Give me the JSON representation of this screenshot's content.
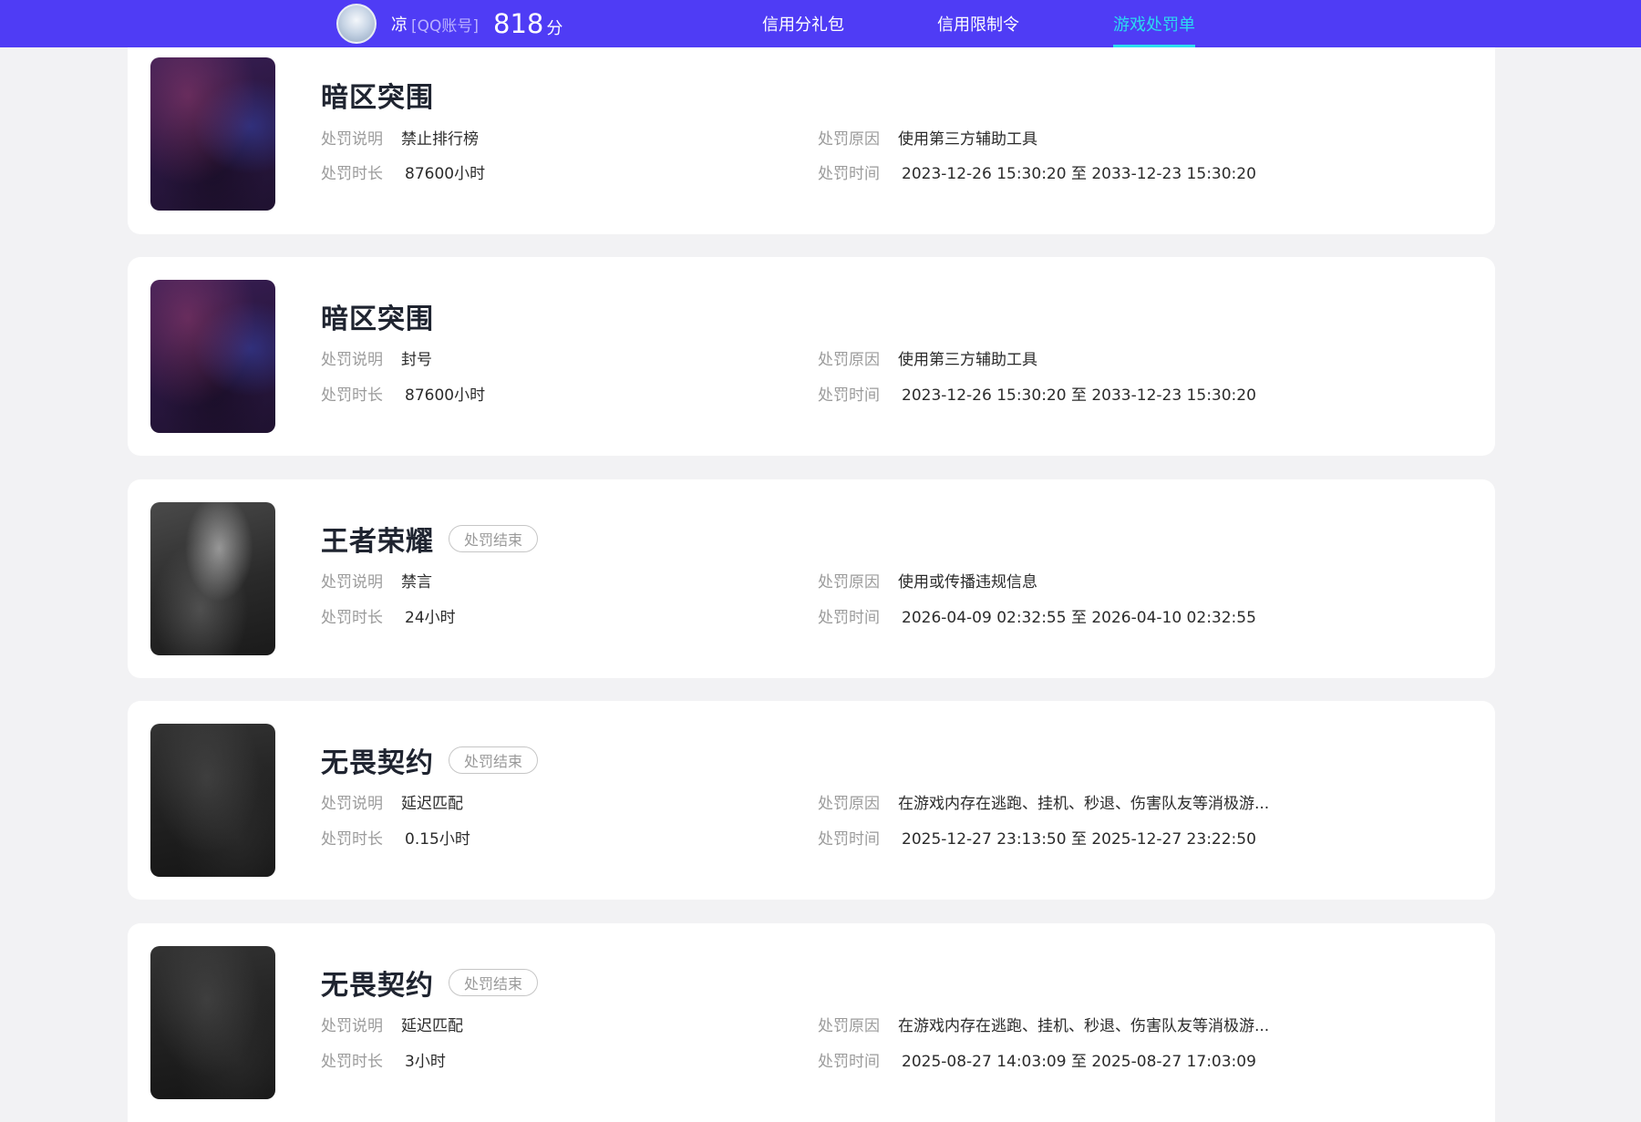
{
  "header": {
    "username": "凉",
    "account_type": "[QQ账号]",
    "score": "818",
    "score_unit": "分",
    "nav": [
      {
        "label": "信用分礼包",
        "active": false
      },
      {
        "label": "信用限制令",
        "active": false
      },
      {
        "label": "游戏处罚单",
        "active": true
      }
    ]
  },
  "labels": {
    "description": "处罚说明",
    "reason": "处罚原因",
    "duration": "处罚时长",
    "time": "处罚时间"
  },
  "records": [
    {
      "game": "暗区突围",
      "status": "",
      "description": "禁止排行榜",
      "reason": "使用第三方辅助工具",
      "duration": "87600小时",
      "time": "2023-12-26 15:30:20 至 2033-12-23 15:30:20"
    },
    {
      "game": "暗区突围",
      "status": "",
      "description": "封号",
      "reason": "使用第三方辅助工具",
      "duration": "87600小时",
      "time": "2023-12-26 15:30:20 至 2033-12-23 15:30:20"
    },
    {
      "game": "王者荣耀",
      "status": "处罚结束",
      "description": "禁言",
      "reason": "使用或传播违规信息",
      "duration": "24小时",
      "time": "2026-04-09 02:32:55 至 2026-04-10 02:32:55"
    },
    {
      "game": "无畏契约",
      "status": "处罚结束",
      "description": "延迟匹配",
      "reason": "在游戏内存在逃跑、挂机、秒退、伤害队友等消极游...",
      "duration": "0.15小时",
      "time": "2025-12-27 23:13:50 至 2025-12-27 23:22:50"
    },
    {
      "game": "无畏契约",
      "status": "处罚结束",
      "description": "延迟匹配",
      "reason": "在游戏内存在逃跑、挂机、秒退、伤害队友等消极游...",
      "duration": "3小时",
      "time": "2025-08-27 14:03:09 至 2025-08-27 17:03:09"
    }
  ]
}
